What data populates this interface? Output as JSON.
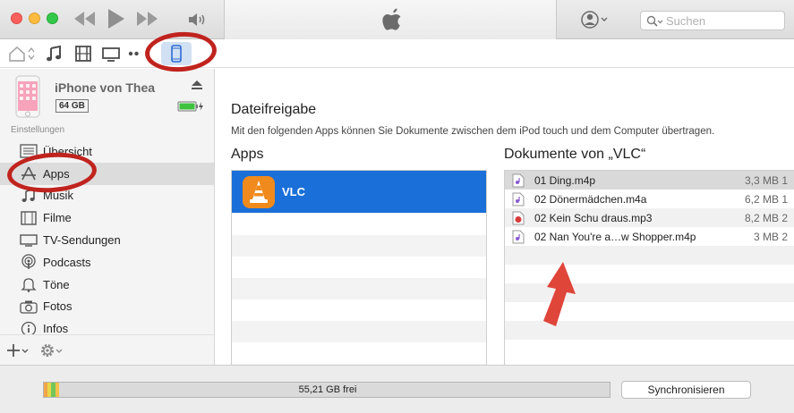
{
  "header": {
    "search": {
      "placeholder": "Suchen"
    }
  },
  "sidebar": {
    "device_name": "iPhone von Thea",
    "capacity": "64 GB",
    "section_label": "Einstellungen",
    "items": [
      {
        "label": "Übersicht",
        "icon": "list-icon"
      },
      {
        "label": "Apps",
        "icon": "apps-icon",
        "selected": true
      },
      {
        "label": "Musik",
        "icon": "music-note-icon"
      },
      {
        "label": "Filme",
        "icon": "film-icon"
      },
      {
        "label": "TV-Sendungen",
        "icon": "tv-icon"
      },
      {
        "label": "Podcasts",
        "icon": "podcast-icon"
      },
      {
        "label": "Töne",
        "icon": "bell-icon"
      },
      {
        "label": "Fotos",
        "icon": "camera-icon"
      },
      {
        "label": "Infos",
        "icon": "info-icon"
      }
    ]
  },
  "main": {
    "title": "Dateifreigabe",
    "description": "Mit den folgenden Apps können Sie Dokumente zwischen dem iPod touch und dem Computer übertragen.",
    "apps_heading": "Apps",
    "apps": [
      {
        "name": "VLC",
        "selected": true
      }
    ],
    "documents_heading": "Dokumente von „VLC“",
    "documents": [
      {
        "name": "01 Ding.m4p",
        "size": "3,3 MB 1"
      },
      {
        "name": "02 Dönermädchen.m4a",
        "size": "6,2 MB 1"
      },
      {
        "name": "02 Kein Schu draus.mp3",
        "size": "8,2 MB 2"
      },
      {
        "name": "02 Nan You're a…w Shopper.m4p",
        "size": "3 MB 2"
      }
    ]
  },
  "footer": {
    "storage_free": "55,21 GB frei",
    "sync_label": "Synchronisieren"
  },
  "colors": {
    "selection_blue": "#1a6fd8",
    "annotation_red": "#c0231e",
    "vlc_orange": "#f08a1c"
  }
}
